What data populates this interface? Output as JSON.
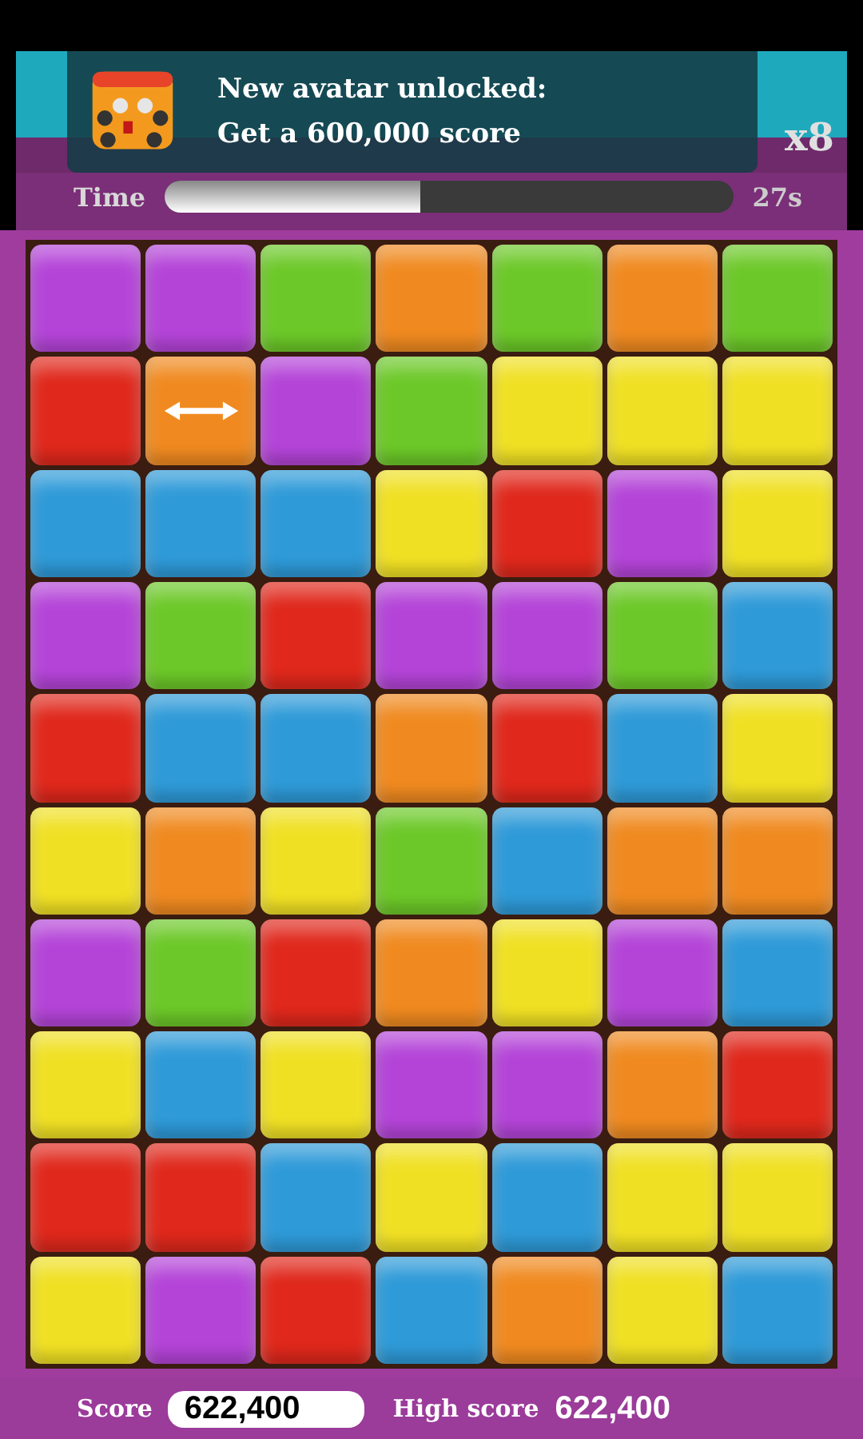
{
  "header": {
    "multiplier": "x8",
    "time_label": "Time",
    "time_bar": {
      "level": 0.45
    },
    "time_left": "27s"
  },
  "notification": {
    "title": "New avatar unlocked:",
    "message": "Get a 600,000 score"
  },
  "board": {
    "rows": [
      [
        {
          "color": "#b444d8",
          "kind": "plain"
        },
        {
          "color": "#b444d8",
          "kind": "plain"
        },
        {
          "color": "#6cc828",
          "kind": "plain"
        },
        {
          "color": "#f08a20",
          "kind": "plain"
        },
        {
          "color": "#6cc828",
          "kind": "plain"
        },
        {
          "color": "#f08a20",
          "kind": "plain"
        },
        {
          "color": "#6cc828",
          "kind": "plain"
        }
      ],
      [
        {
          "color": "#e0281c",
          "kind": "plain"
        },
        {
          "color": "#f08a20",
          "kind": "swap-hint"
        },
        {
          "color": "#b444d8",
          "kind": "plain"
        },
        {
          "color": "#6cc828",
          "kind": "plain"
        },
        {
          "color": "#f0e024",
          "kind": "plain"
        },
        {
          "color": "#f0e024",
          "kind": "plain"
        },
        {
          "color": "#f0e024",
          "kind": "plain"
        }
      ],
      [
        {
          "color": "#2e9ad8",
          "kind": "plain"
        },
        {
          "color": "#2e9ad8",
          "kind": "plain"
        },
        {
          "color": "#2e9ad8",
          "kind": "plain"
        },
        {
          "color": "#f0e024",
          "kind": "plain"
        },
        {
          "color": "#e0281c",
          "kind": "plain"
        },
        {
          "color": "#b444d8",
          "kind": "plain"
        },
        {
          "color": "#f0e024",
          "kind": "plain"
        }
      ],
      [
        {
          "color": "#b444d8",
          "kind": "plain"
        },
        {
          "color": "#6cc828",
          "kind": "plain"
        },
        {
          "color": "#e0281c",
          "kind": "plain"
        },
        {
          "color": "#b444d8",
          "kind": "plain"
        },
        {
          "color": "#b444d8",
          "kind": "plain"
        },
        {
          "color": "#6cc828",
          "kind": "plain"
        },
        {
          "color": "#2e9ad8",
          "kind": "plain"
        }
      ],
      [
        {
          "color": "#e0281c",
          "kind": "plain"
        },
        {
          "color": "#2e9ad8",
          "kind": "plain"
        },
        {
          "color": "#2e9ad8",
          "kind": "plain"
        },
        {
          "color": "#f08a20",
          "kind": "plain"
        },
        {
          "color": "#e0281c",
          "kind": "plain"
        },
        {
          "color": "#2e9ad8",
          "kind": "plain"
        },
        {
          "color": "#f0e024",
          "kind": "plain"
        }
      ],
      [
        {
          "color": "#f0e024",
          "kind": "plain"
        },
        {
          "color": "#f08a20",
          "kind": "plain"
        },
        {
          "color": "#f0e024",
          "kind": "plain"
        },
        {
          "color": "#6cc828",
          "kind": "plain"
        },
        {
          "color": "#2e9ad8",
          "kind": "plain"
        },
        {
          "color": "#f08a20",
          "kind": "plain"
        },
        {
          "color": "#f08a20",
          "kind": "plain"
        }
      ],
      [
        {
          "color": "#b444d8",
          "kind": "plain"
        },
        {
          "color": "#6cc828",
          "kind": "plain"
        },
        {
          "color": "#e0281c",
          "kind": "plain"
        },
        {
          "color": "#f08a20",
          "kind": "plain"
        },
        {
          "color": "#f0e024",
          "kind": "plain"
        },
        {
          "color": "#b444d8",
          "kind": "plain"
        },
        {
          "color": "#2e9ad8",
          "kind": "plain"
        }
      ],
      [
        {
          "color": "#f0e024",
          "kind": "plain"
        },
        {
          "color": "#2e9ad8",
          "kind": "plain"
        },
        {
          "color": "#f0e024",
          "kind": "plain"
        },
        {
          "color": "#b444d8",
          "kind": "plain"
        },
        {
          "color": "#b444d8",
          "kind": "plain"
        },
        {
          "color": "#f08a20",
          "kind": "plain"
        },
        {
          "color": "#e0281c",
          "kind": "plain"
        }
      ],
      [
        {
          "color": "#e0281c",
          "kind": "plain"
        },
        {
          "color": "#e0281c",
          "kind": "plain"
        },
        {
          "color": "#2e9ad8",
          "kind": "plain"
        },
        {
          "color": "#f0e024",
          "kind": "plain"
        },
        {
          "color": "#2e9ad8",
          "kind": "plain"
        },
        {
          "color": "#f0e024",
          "kind": "plain"
        },
        {
          "color": "#f0e024",
          "kind": "plain"
        }
      ],
      [
        {
          "color": "#f0e024",
          "kind": "plain"
        },
        {
          "color": "#b444d8",
          "kind": "plain"
        },
        {
          "color": "#e0281c",
          "kind": "plain"
        },
        {
          "color": "#2e9ad8",
          "kind": "plain"
        },
        {
          "color": "#f08a20",
          "kind": "plain"
        },
        {
          "color": "#f0e024",
          "kind": "plain"
        },
        {
          "color": "#2e9ad8",
          "kind": "plain"
        }
      ]
    ]
  },
  "footer": {
    "score_label": "Score",
    "score": "622,400",
    "high_score_label": "High score",
    "high_score": "622,400"
  }
}
